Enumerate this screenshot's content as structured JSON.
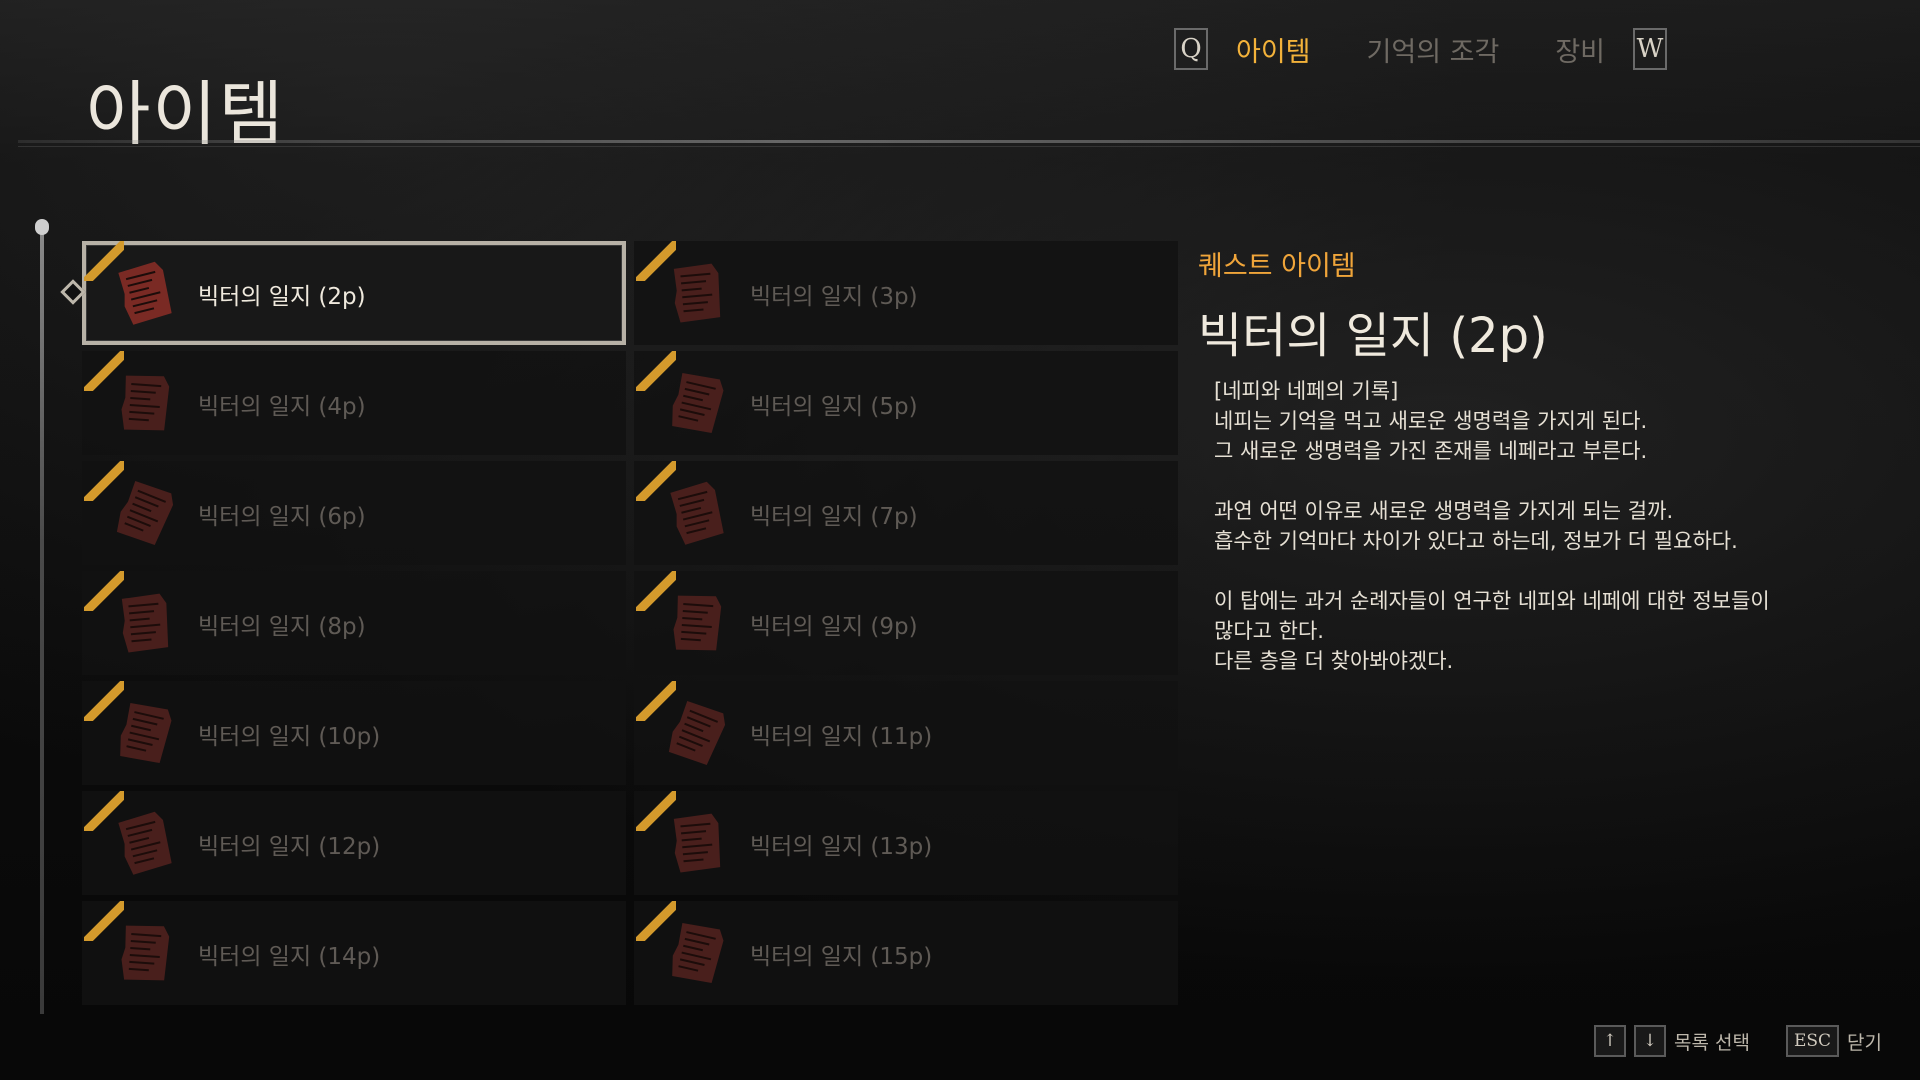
{
  "header": {
    "title": "아이템",
    "tabs": [
      {
        "label": "아이템",
        "active": true
      },
      {
        "label": "기억의 조각",
        "active": false
      },
      {
        "label": "장비",
        "active": false
      }
    ],
    "prev_key": "Q",
    "next_key": "W"
  },
  "items": [
    {
      "label": "빅터의 일지 (2p)",
      "selected": true
    },
    {
      "label": "빅터의 일지 (3p)",
      "selected": false
    },
    {
      "label": "빅터의 일지 (4p)",
      "selected": false
    },
    {
      "label": "빅터의 일지 (5p)",
      "selected": false
    },
    {
      "label": "빅터의 일지 (6p)",
      "selected": false
    },
    {
      "label": "빅터의 일지 (7p)",
      "selected": false
    },
    {
      "label": "빅터의 일지 (8p)",
      "selected": false
    },
    {
      "label": "빅터의 일지 (9p)",
      "selected": false
    },
    {
      "label": "빅터의 일지 (10p)",
      "selected": false
    },
    {
      "label": "빅터의 일지 (11p)",
      "selected": false
    },
    {
      "label": "빅터의 일지 (12p)",
      "selected": false
    },
    {
      "label": "빅터의 일지 (13p)",
      "selected": false
    },
    {
      "label": "빅터의 일지 (14p)",
      "selected": false
    },
    {
      "label": "빅터의 일지 (15p)",
      "selected": false
    }
  ],
  "detail": {
    "category": "퀘스트 아이템",
    "title": "빅터의 일지 (2p)",
    "lines": [
      "[네피와 네페의 기록]",
      "네피는 기억을 먹고 새로운 생명력을 가지게 된다.",
      "그 새로운 생명력을 가진 존재를 네페라고 부른다.",
      "",
      "과연 어떤 이유로 새로운 생명력을 가지게 되는 걸까.",
      "흡수한 기억마다 차이가 있다고 하는데, 정보가 더 필요하다.",
      "",
      "이 탑에는 과거 순례자들이 연구한 네피와 네페에 대한 정보들이",
      "많다고 한다.",
      "다른 층을 더 찾아봐야겠다."
    ]
  },
  "footer": {
    "up_key": "↑",
    "down_key": "↓",
    "select_label": "목록 선택",
    "esc_key": "ESC",
    "close_label": "닫기"
  },
  "colors": {
    "accent": "#f3b23a",
    "category": "#f0a53a",
    "stripe": "#d49a2c",
    "icon": "#5c2420"
  }
}
